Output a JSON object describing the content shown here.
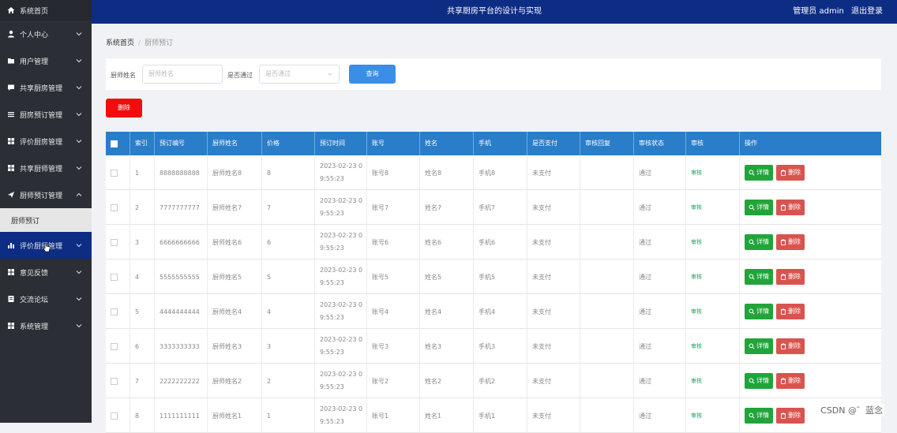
{
  "topbar": {
    "title": "共享厨房平台的设计与实现",
    "user_label": "管理员 admin",
    "logout": "退出登录"
  },
  "sidebar": {
    "home": "系统首页",
    "items": [
      {
        "label": "个人中心",
        "icon": "user-icon"
      },
      {
        "label": "用户管理",
        "icon": "folder-icon"
      },
      {
        "label": "共享厨房管理",
        "icon": "comment-icon"
      },
      {
        "label": "厨房预订管理",
        "icon": "list-icon"
      },
      {
        "label": "评价厨房管理",
        "icon": "grid-icon"
      },
      {
        "label": "共享厨师管理",
        "icon": "grid-icon"
      },
      {
        "label": "厨师预订管理",
        "icon": "send-icon",
        "expanded": true
      },
      {
        "label": "评价厨师管理",
        "icon": "bar-chart-icon",
        "active": true
      },
      {
        "label": "意见反馈",
        "icon": "grid-icon"
      },
      {
        "label": "交流论坛",
        "icon": "doc-icon"
      },
      {
        "label": "系统管理",
        "icon": "grid-icon"
      }
    ],
    "sub_item": "厨师预订"
  },
  "breadcrumb": {
    "home": "系统首页",
    "separator": "/",
    "current": "厨师预订"
  },
  "search": {
    "name_label": "厨师姓名",
    "name_placeholder": "厨师姓名",
    "paid_label": "是否通过",
    "paid_placeholder": "是否通过",
    "query_button": "查询"
  },
  "delete_button": "删除",
  "table": {
    "headers": [
      "索引",
      "预订编号",
      "厨师姓名",
      "价格",
      "预订时间",
      "账号",
      "姓名",
      "手机",
      "是否支付",
      "审核回复",
      "审核状态",
      "审核",
      "操作"
    ],
    "rows": [
      {
        "index": "1",
        "order_no": "8888888888",
        "chef": "厨师姓名8",
        "price": "8",
        "time": "2023-02-23 0\n9:55:23",
        "account": "账号8",
        "name": "姓名8",
        "phone": "手机8",
        "paid": "未支付",
        "reply": "",
        "status": "通过",
        "review": "审核"
      },
      {
        "index": "2",
        "order_no": "7777777777",
        "chef": "厨师姓名7",
        "price": "7",
        "time": "2023-02-23 0\n9:55:23",
        "account": "账号7",
        "name": "姓名7",
        "phone": "手机7",
        "paid": "未支付",
        "reply": "",
        "status": "通过",
        "review": "审核"
      },
      {
        "index": "3",
        "order_no": "6666666666",
        "chef": "厨师姓名6",
        "price": "6",
        "time": "2023-02-23 0\n9:55:23",
        "account": "账号6",
        "name": "姓名6",
        "phone": "手机6",
        "paid": "未支付",
        "reply": "",
        "status": "通过",
        "review": "审核"
      },
      {
        "index": "4",
        "order_no": "5555555555",
        "chef": "厨师姓名5",
        "price": "5",
        "time": "2023-02-23 0\n9:55:23",
        "account": "账号5",
        "name": "姓名5",
        "phone": "手机5",
        "paid": "未支付",
        "reply": "",
        "status": "通过",
        "review": "审核"
      },
      {
        "index": "5",
        "order_no": "4444444444",
        "chef": "厨师姓名4",
        "price": "4",
        "time": "2023-02-23 0\n9:55:23",
        "account": "账号4",
        "name": "姓名4",
        "phone": "手机4",
        "paid": "未支付",
        "reply": "",
        "status": "通过",
        "review": "审核"
      },
      {
        "index": "6",
        "order_no": "3333333333",
        "chef": "厨师姓名3",
        "price": "3",
        "time": "2023-02-23 0\n9:55:23",
        "account": "账号3",
        "name": "姓名3",
        "phone": "手机3",
        "paid": "未支付",
        "reply": "",
        "status": "通过",
        "review": "审核"
      },
      {
        "index": "7",
        "order_no": "2222222222",
        "chef": "厨师姓名2",
        "price": "2",
        "time": "2023-02-23 0\n9:55:23",
        "account": "账号2",
        "name": "姓名2",
        "phone": "手机2",
        "paid": "未支付",
        "reply": "",
        "status": "通过",
        "review": "审核"
      },
      {
        "index": "8",
        "order_no": "1111111111",
        "chef": "厨师姓名1",
        "price": "1",
        "time": "2023-02-23 0\n9:55:23",
        "account": "账号1",
        "name": "姓名1",
        "phone": "手机1",
        "paid": "未支付",
        "reply": "",
        "status": "通过",
        "review": "审核"
      }
    ],
    "detail_label": "详情",
    "delete_label": "删除"
  },
  "watermark": "CSDN @゛蓝念",
  "colors": {
    "topbar": "#0d2d84",
    "sidebar": "#2b2f35",
    "table_header": "#2a7dc9",
    "delete_button": "#f20c0c",
    "detail_button": "#21a53a",
    "row_delete_button": "#d9534f",
    "query_button": "#3a8ee6",
    "review_link": "#1aa260"
  }
}
